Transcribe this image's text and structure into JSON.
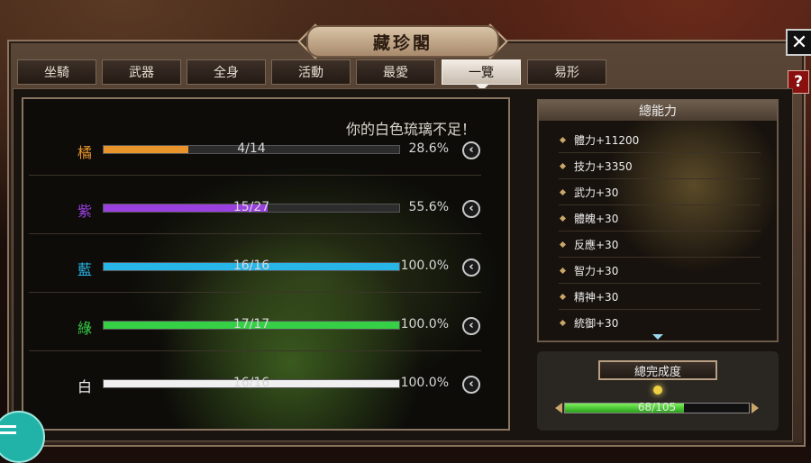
{
  "window": {
    "title": "藏珍閣",
    "close_icon": "✕",
    "help_icon": "?"
  },
  "tabs": [
    {
      "label": "坐騎",
      "active": false
    },
    {
      "label": "武器",
      "active": false
    },
    {
      "label": "全身",
      "active": false
    },
    {
      "label": "活動",
      "active": false
    },
    {
      "label": "最愛",
      "active": false
    },
    {
      "label": "一覽",
      "active": true
    },
    {
      "label": "易形",
      "active": false
    }
  ],
  "collection": {
    "warning": "你的白色琉璃不足！",
    "rows": [
      {
        "grade": "橘",
        "color": "#e8942a",
        "progress": "4/14",
        "current": 4,
        "total": 14,
        "percent": "28.6%"
      },
      {
        "grade": "紫",
        "color": "#9a3fe0",
        "progress": "15/27",
        "current": 15,
        "total": 27,
        "percent": "55.6%"
      },
      {
        "grade": "藍",
        "color": "#28b6e8",
        "progress": "16/16",
        "current": 16,
        "total": 16,
        "percent": "100.0%"
      },
      {
        "grade": "綠",
        "color": "#36d046",
        "progress": "17/17",
        "current": 17,
        "total": 17,
        "percent": "100.0%"
      },
      {
        "grade": "白",
        "color": "#f0f0f0",
        "progress": "16/16",
        "current": 16,
        "total": 16,
        "percent": "100.0%"
      }
    ]
  },
  "stats": {
    "header": "總能力",
    "items": [
      "體力+11200",
      "技力+3350",
      "武力+30",
      "體魄+30",
      "反應+30",
      "智力+30",
      "精神+30",
      "統御+30"
    ]
  },
  "completion": {
    "label": "總完成度",
    "progress": "68/105",
    "current": 68,
    "total": 105
  }
}
